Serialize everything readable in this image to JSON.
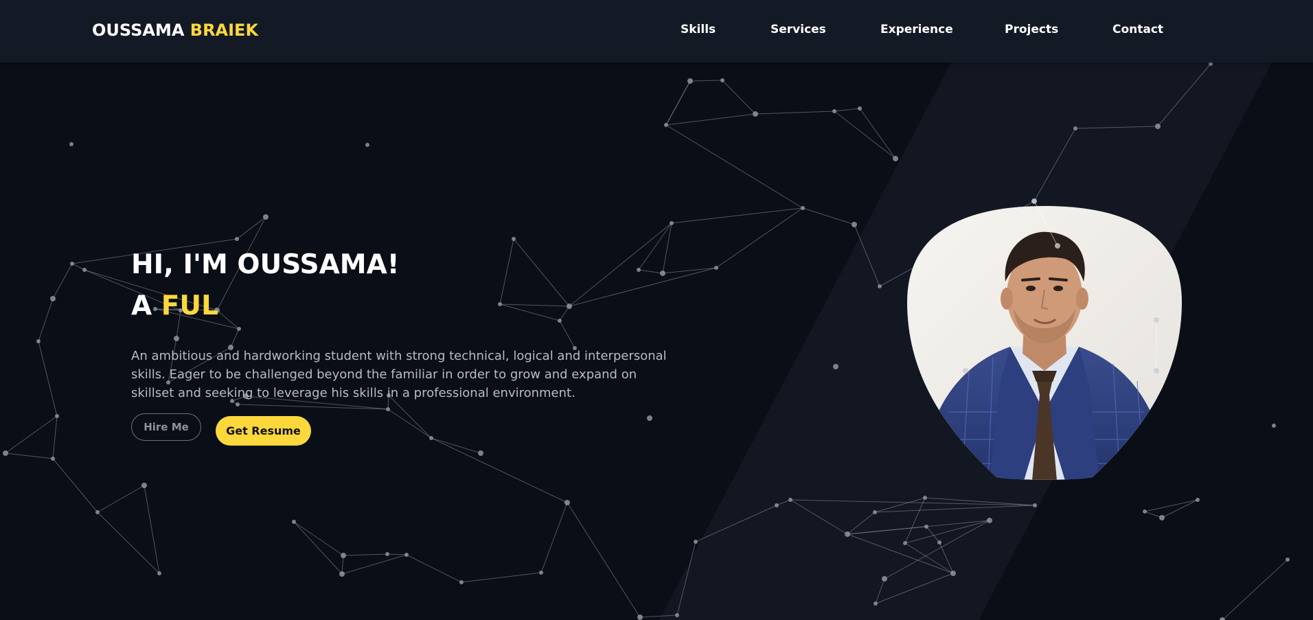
{
  "header": {
    "logo_first": "OUSSAMA",
    "logo_second": "BRAIEK",
    "nav": [
      {
        "label": "Skills"
      },
      {
        "label": "Services"
      },
      {
        "label": "Experience"
      },
      {
        "label": "Projects"
      },
      {
        "label": "Contact"
      }
    ]
  },
  "hero": {
    "greeting": "HI, I'M OUSSAMA!",
    "tagline_prefix": "A",
    "tagline_typed": "FUL",
    "description": "An ambitious and hardworking student with strong technical, logical and interpersonal skills. Eager to be challenged beyond the familiar in order to grow and expand on skillset and seeking to leverage his skills in a professional environment.",
    "hire_label": "Hire Me",
    "resume_label": "Get Resume"
  },
  "colors": {
    "accent": "#fcd83c",
    "background": "#0a0e16",
    "navbar": "#141a25",
    "text": "#ffffff",
    "muted_text": "#b7bcc6"
  }
}
